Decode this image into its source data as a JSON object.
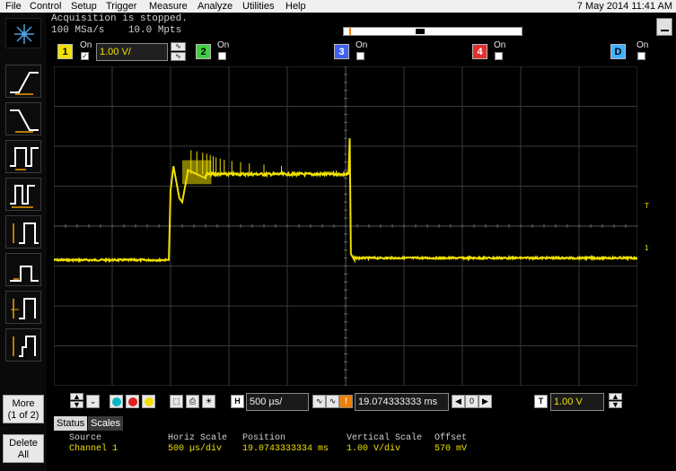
{
  "menu": [
    "File",
    "Control",
    "Setup",
    "Trigger",
    "Measure",
    "Analyze",
    "Utilities",
    "Help"
  ],
  "datetime": "7 May 2014 11:41 AM",
  "acquisition": {
    "line1": "Acquisition is stopped.",
    "line2": "100 MSa/s    10.0 Mpts"
  },
  "channels": [
    {
      "num": "1",
      "on_label": "On",
      "color": "#f0e000",
      "checked": true
    },
    {
      "num": "2",
      "on_label": "On",
      "color": "#40d040",
      "checked": false
    },
    {
      "num": "3",
      "on_label": "On",
      "color": "#4060f0",
      "checked": false
    },
    {
      "num": "4",
      "on_label": "On",
      "color": "#e03030",
      "checked": false
    },
    {
      "num": "D",
      "on_label": "On",
      "color": "#40b0ff",
      "checked": false
    }
  ],
  "ch1_scale": "1.00 V/",
  "trace_color": "#f0e000",
  "side": {
    "more": "More",
    "more_sub": "(1 of 2)",
    "delete": "Delete",
    "delete_sub": "All"
  },
  "controls": {
    "h_label": "H",
    "h_scale": "500 µs/",
    "delay": "19.074333333 ms",
    "zero": "0",
    "t_label": "T",
    "trigger_level": "1.00 V"
  },
  "tabs": {
    "status": "Status",
    "scales": "Scales"
  },
  "scales": {
    "headers": {
      "source": "Source",
      "horiz": "Horiz Scale",
      "position": "Position",
      "vert": "Vertical Scale",
      "offset": "Offset"
    },
    "values": {
      "source": "Channel 1",
      "horiz": "500 µs/div",
      "position": "19.0743333334 ms",
      "vert": "1.00 V/div",
      "offset": "570 mV"
    }
  },
  "markers": {
    "trigger": "T",
    "ground": "1"
  }
}
